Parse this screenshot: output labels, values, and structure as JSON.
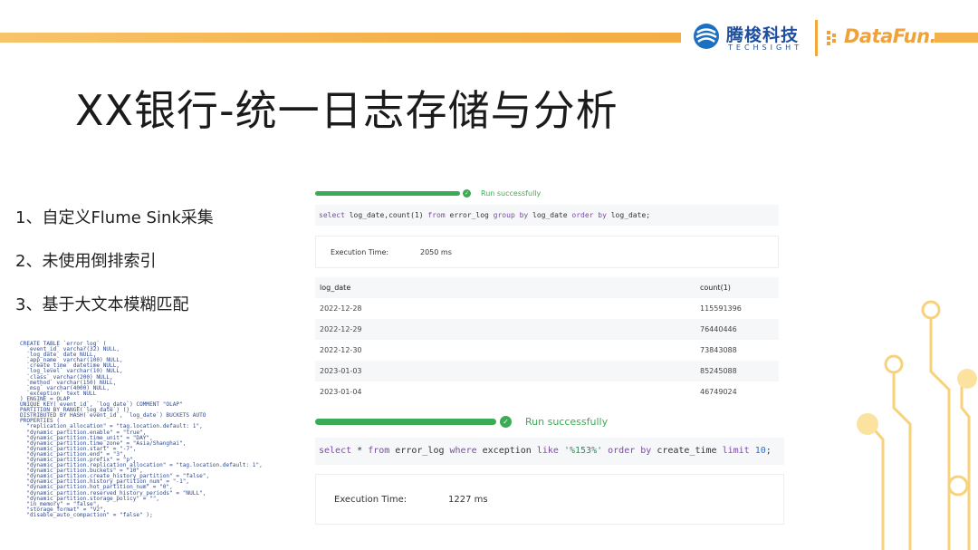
{
  "header": {
    "logo_techsight_cn": "腾梭科技",
    "logo_techsight_en": "TECHSIGHT",
    "logo_datafun": "DataFun."
  },
  "title": "XX银行-统一日志存储与分析",
  "bullets": [
    "1、自定义Flume Sink采集",
    "2、未使用倒排索引",
    "3、基于大文本模糊匹配"
  ],
  "ddl": [
    "CREATE TABLE `error_log` (",
    "  `event_id` varchar(32) NULL,",
    "  `log_date` date NULL,",
    "  `app_name` varchar(100) NULL,",
    "  `create_time` datetime NULL,",
    "  `log_level` varchar(10) NULL,",
    "  `class` varchar(200) NULL,",
    "  `method` varchar(150) NULL,",
    "  `msg` varchar(4000) NULL,",
    "  `exception` text NULL",
    ") ENGINE = OLAP",
    "UNIQUE KEY(`event_id`, `log_date`) COMMENT \"OLAP\"",
    "PARTITION BY RANGE(`log_date`) ()",
    "DISTRIBUTED BY HASH(`event_id`, `log_date`) BUCKETS AUTO",
    "PROPERTIES (",
    "  \"replication_allocation\" = \"tag.location.default: 1\",",
    "  \"dynamic_partition.enable\" = \"true\",",
    "  \"dynamic_partition.time_unit\" = \"DAY\",",
    "  \"dynamic_partition.time_zone\" = \"Asia/Shanghai\",",
    "  \"dynamic_partition.start\" = \"-7\",",
    "  \"dynamic_partition.end\" = \"3\",",
    "  \"dynamic_partition.prefix\" = \"p\",",
    "  \"dynamic_partition.replication_allocation\" = \"tag.location.default: 1\",",
    "  \"dynamic_partition.buckets\" = \"10\",",
    "  \"dynamic_partition.create_history_partition\" = \"false\",",
    "  \"dynamic_partition.history_partition_num\" = \"-1\",",
    "  \"dynamic_partition.hot_partition_num\" = \"0\",",
    "  \"dynamic_partition.reserved_history_periods\" = \"NULL\",",
    "  \"dynamic_partition.storage_policy\" = \"\",",
    "  \"in_memory\" = \"false\",",
    "  \"storage_format\" = \"V2\",",
    "  \"disable_auto_compaction\" = \"false\" );"
  ],
  "query1": {
    "status": "Run successfully",
    "sql_kw_select": "select",
    "sql_mid1": " log_date,count(1) ",
    "sql_kw_from": "from",
    "sql_mid2": " error_log ",
    "sql_kw_group": "group by",
    "sql_mid3": " log_date ",
    "sql_kw_order": "order by",
    "sql_mid4": " log_date;",
    "exec_label": "Execution Time:",
    "exec_value": "2050 ms",
    "columns": [
      "log_date",
      "count(1)"
    ],
    "rows": [
      [
        "2022-12-28",
        "115591396"
      ],
      [
        "2022-12-29",
        "76440446"
      ],
      [
        "2022-12-30",
        "73843088"
      ],
      [
        "2023-01-03",
        "85245088"
      ],
      [
        "2023-01-04",
        "46749024"
      ]
    ]
  },
  "query2": {
    "status": "Run successfully",
    "sql_kw_select": "select",
    "sql_mid1": " * ",
    "sql_kw_from": "from",
    "sql_mid2": " error_log  ",
    "sql_kw_where": "where",
    "sql_mid3": " exception ",
    "sql_kw_like": "like",
    "sql_str": " '%153%' ",
    "sql_kw_order": "order by",
    "sql_mid4": " create_time ",
    "sql_kw_limit": "limit",
    "sql_num": " 10",
    "sql_end": ";",
    "exec_label": "Execution Time:",
    "exec_value": "1227 ms"
  },
  "colors": {
    "accent_orange": "#f5b14b",
    "success_green": "#3cab55",
    "brand_blue": "#1d4f9e"
  }
}
